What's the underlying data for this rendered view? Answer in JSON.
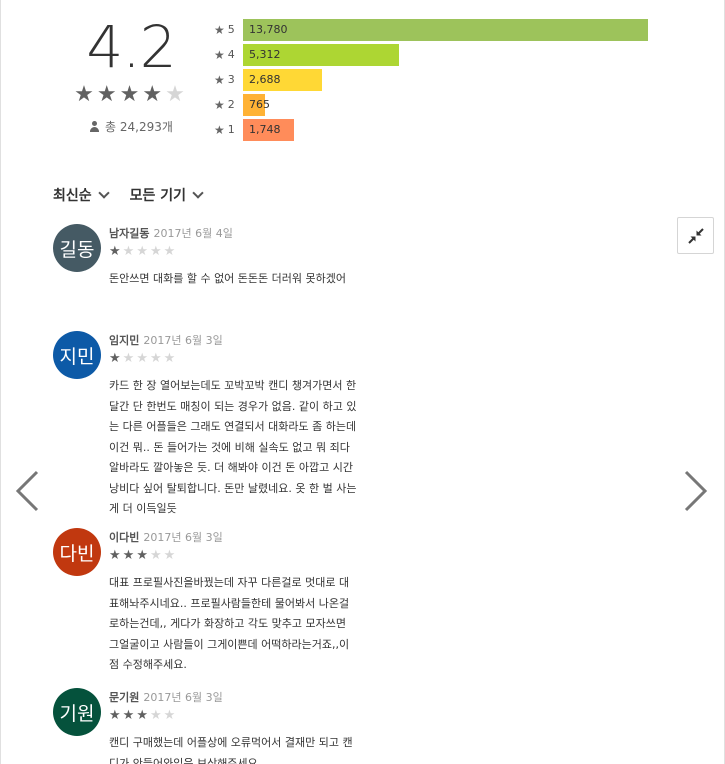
{
  "summary": {
    "average": "4.2",
    "star_rating": 4,
    "total_label": "총 24,293개"
  },
  "histogram": [
    {
      "star": "5",
      "count": "13,780",
      "value": 13780,
      "color": "#9dc35b"
    },
    {
      "star": "4",
      "count": "5,312",
      "value": 5312,
      "color": "#add633"
    },
    {
      "star": "3",
      "count": "2,688",
      "value": 2688,
      "color": "#ffd835"
    },
    {
      "star": "2",
      "count": "765",
      "value": 765,
      "color": "#ffb235"
    },
    {
      "star": "1",
      "count": "1,748",
      "value": 1748,
      "color": "#ff8c5a"
    }
  ],
  "filters": {
    "sort_label": "최신순",
    "device_label": "모든 기기"
  },
  "reviews": [
    {
      "avatar_text": "길동",
      "avatar_color": "#455a64",
      "author": "남자길동",
      "date": "2017년 6월 4일",
      "rating": 1,
      "text": "돈안쓰면 대화를 할 수 없어 돈돈돈 더러워 못하겠어"
    },
    {
      "avatar_text": "지민",
      "avatar_color": "#0d5aa7",
      "author": "임지민",
      "date": "2017년 6월 3일",
      "rating": 1,
      "text": "카드 한 장 열어보는데도 꼬박꼬박 캔디 챙겨가면서 한 달간 단 한번도 매칭이 되는 경우가 없음. 같이 하고 있는 다른 어플들은 그래도 연결되서 대화라도 좀 하는데 이건 뭐.. 돈 들어가는 것에 비해 실속도 없고 뭐 죄다 알바라도 깔아놓은 듯. 더 해봐야 이건 돈 아깝고 시간 낭비다 싶어 탈퇴합니다. 돈만 날렸네요. 옷 한 벌 사는 게 더 이득일듯"
    },
    {
      "avatar_text": "다빈",
      "avatar_color": "#c1380f",
      "author": "이다빈",
      "date": "2017년 6월 3일",
      "rating": 3,
      "text": "대표 프로필사진을바꿨는데 자꾸 다른걸로 멋대로 대표해놔주시네요.. 프로필사람들한테 물어봐서 나온걸로하는건데,, 게다가 화장하고 각도 맞추고 모자쓰면 그얼굴이고 사람들이 그게이쁜데 어떡하라는거죠,,이점 수정해주세요."
    },
    {
      "avatar_text": "기원",
      "avatar_color": "#05523c",
      "author": "문기원",
      "date": "2017년 6월 3일",
      "rating": 3,
      "text": "캔디 구매했는데 어플상에 오류먹어서 결재만 되고 캔디가 안들어와있음 보상해주세요"
    }
  ],
  "icons": {
    "collapse": "collapse-icon",
    "prev": "chevron-left-icon",
    "next": "chevron-right-icon",
    "person": "person-icon"
  }
}
